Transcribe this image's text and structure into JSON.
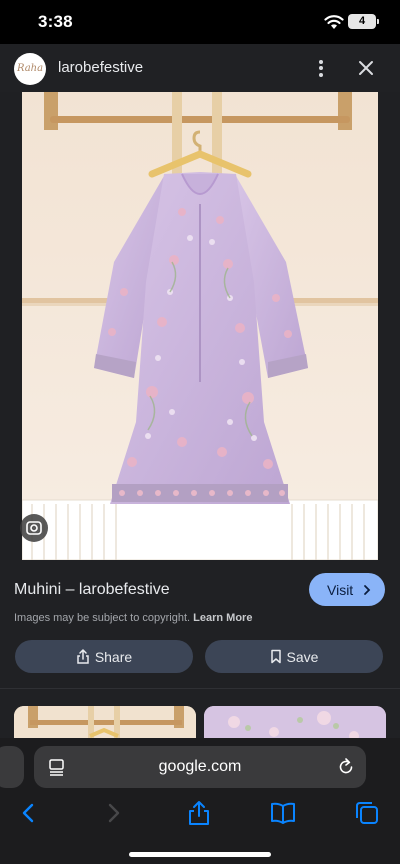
{
  "status_bar": {
    "time": "3:38",
    "battery": "4"
  },
  "header": {
    "avatar_text": "Raha",
    "site_name": "larobefestive"
  },
  "result": {
    "title": "Muhini – larobefestive",
    "visit_label": "Visit",
    "copyright_text": "Images may be subject to copyright.",
    "learn_more": "Learn More",
    "share_label": "Share",
    "save_label": "Save"
  },
  "browser": {
    "address": "google.com"
  },
  "colors": {
    "accent": "#8ab4f8",
    "panel": "#202124",
    "button": "#3c4556",
    "dress": "#c8b3dc"
  }
}
